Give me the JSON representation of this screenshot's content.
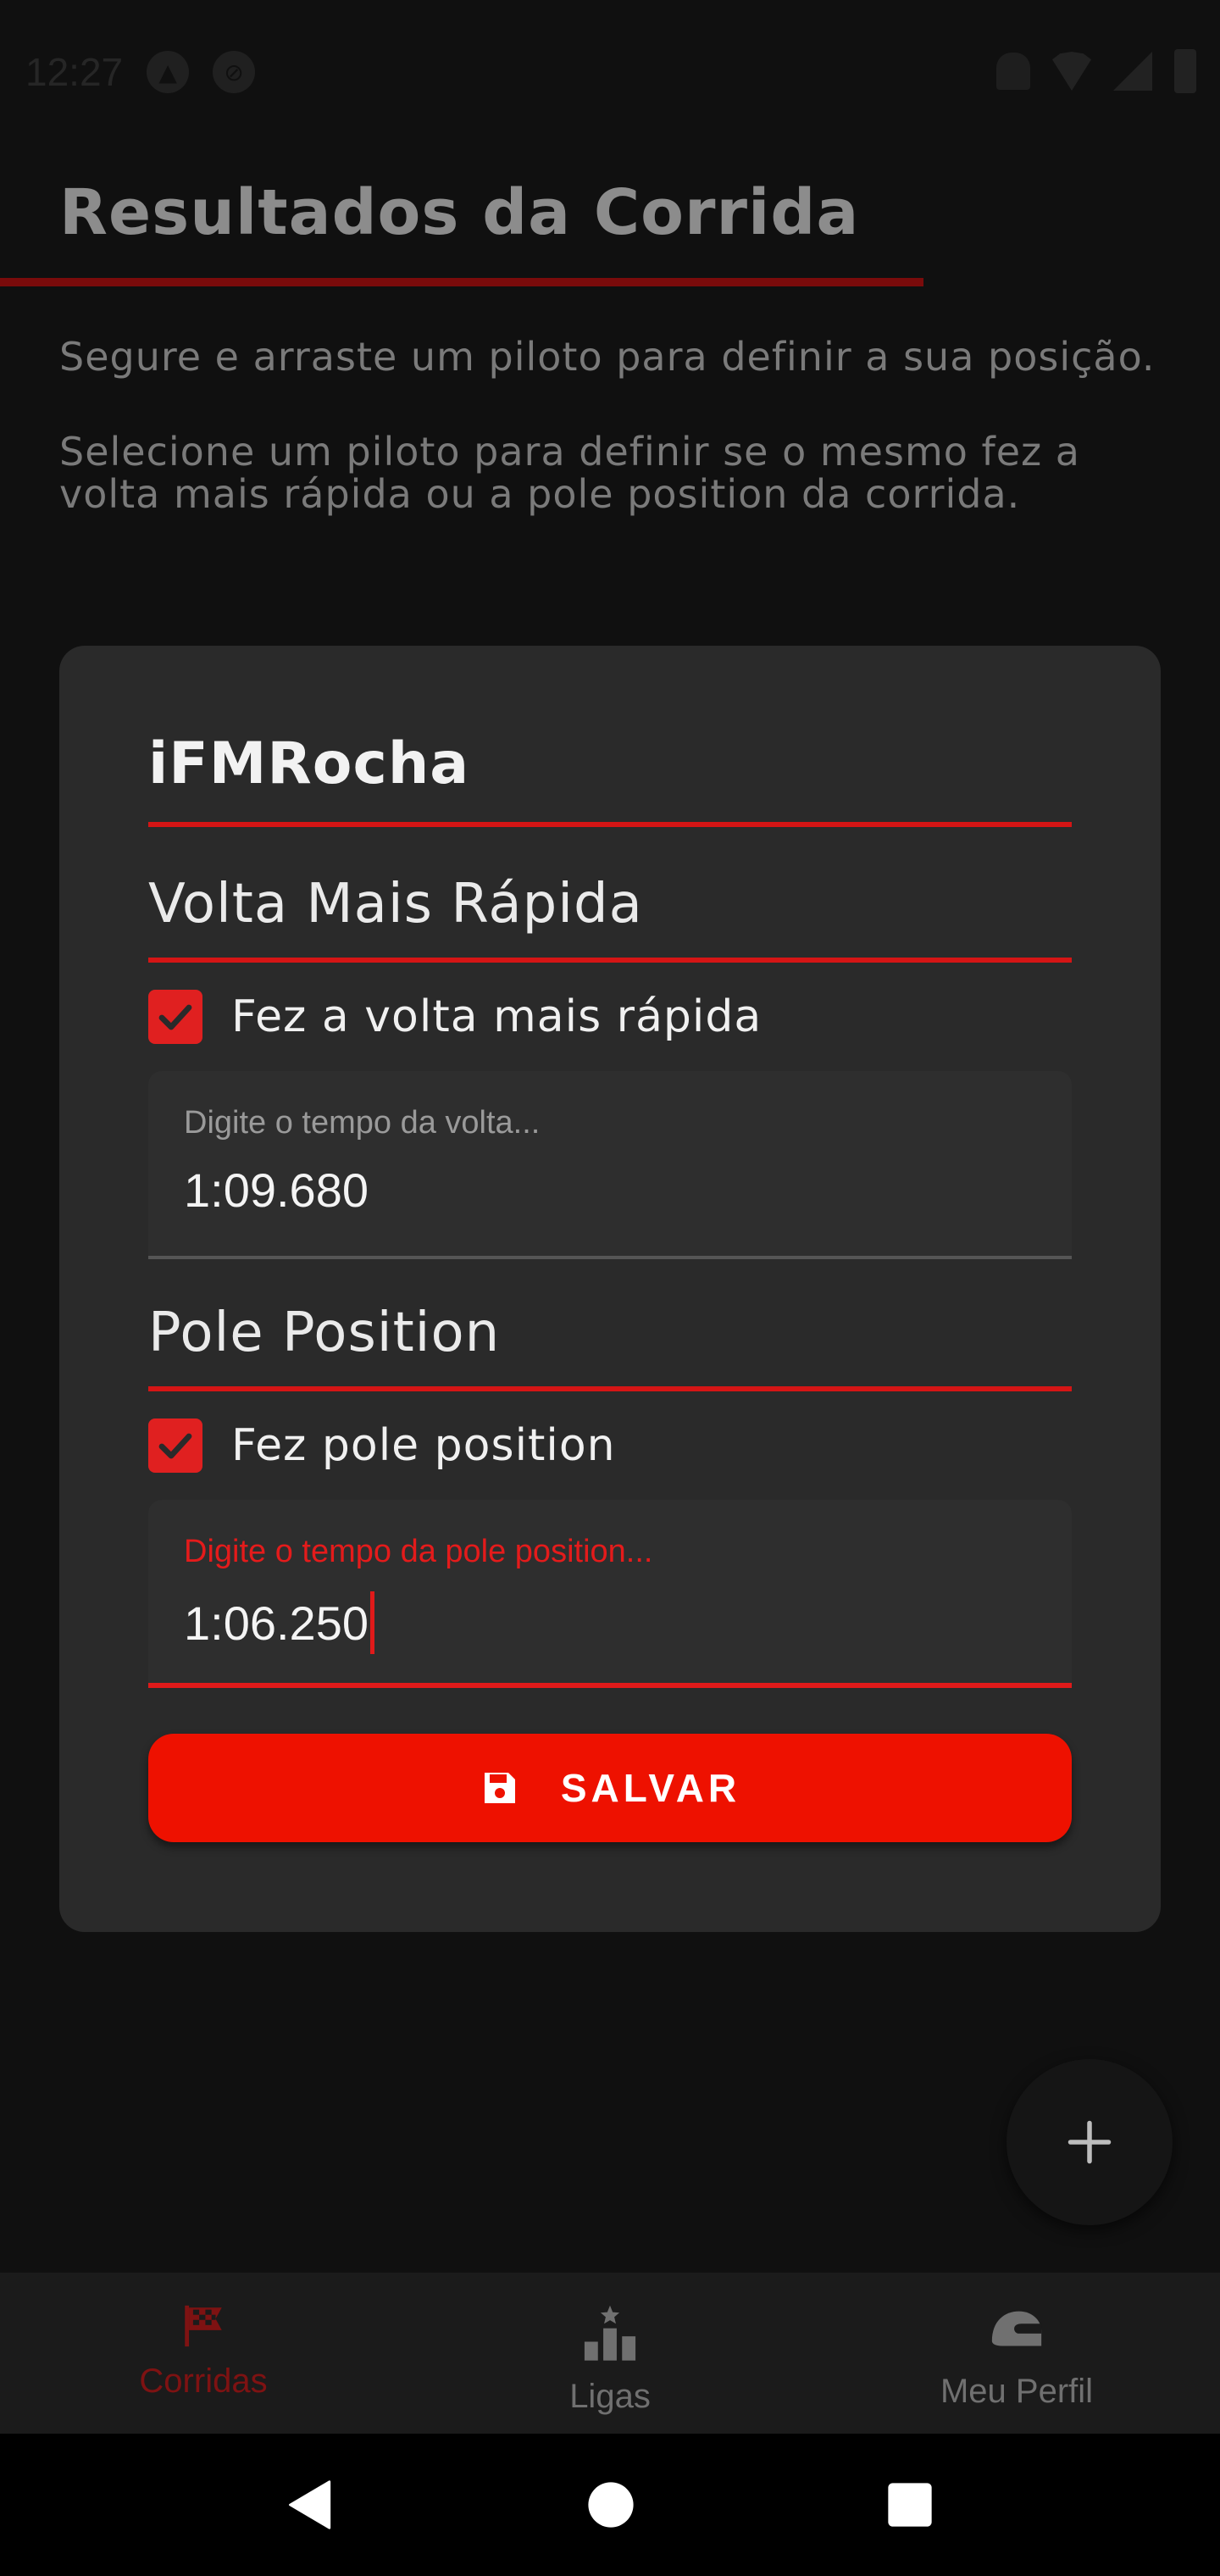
{
  "status_bar": {
    "time": "12:27"
  },
  "header": {
    "title": "Resultados da Corrida"
  },
  "instructions": {
    "line1": "Segure e arraste um piloto para definir a sua posição.",
    "line2": "Selecione um piloto para definir se o mesmo fez a volta mais rápida ou a pole position da corrida."
  },
  "card": {
    "driver_name": "iFMRocha",
    "fastest_lap": {
      "section_title": "Volta Mais Rápida",
      "checkbox_label": "Fez a volta mais rápida",
      "checked": true,
      "input_label": "Digite o tempo da volta...",
      "input_value": "1:09.680"
    },
    "pole_position": {
      "section_title": "Pole Position",
      "checkbox_label": "Fez pole position",
      "checked": true,
      "input_label": "Digite o tempo da pole position...",
      "input_value": "1:06.250"
    },
    "save_button": {
      "label": "SALVAR",
      "icon": "save-icon"
    }
  },
  "fab": {
    "icon": "plus-icon"
  },
  "bottom_nav": {
    "items": [
      {
        "label": "Corridas",
        "icon": "checkered-flag-icon",
        "active": true
      },
      {
        "label": "Ligas",
        "icon": "podium-icon",
        "active": false
      },
      {
        "label": "Meu Perfil",
        "icon": "helmet-icon",
        "active": false
      }
    ]
  },
  "colors": {
    "accent": "#ee1100",
    "background": "#101010",
    "card": "#2a2a2a",
    "active_nav": "#7e1212"
  }
}
